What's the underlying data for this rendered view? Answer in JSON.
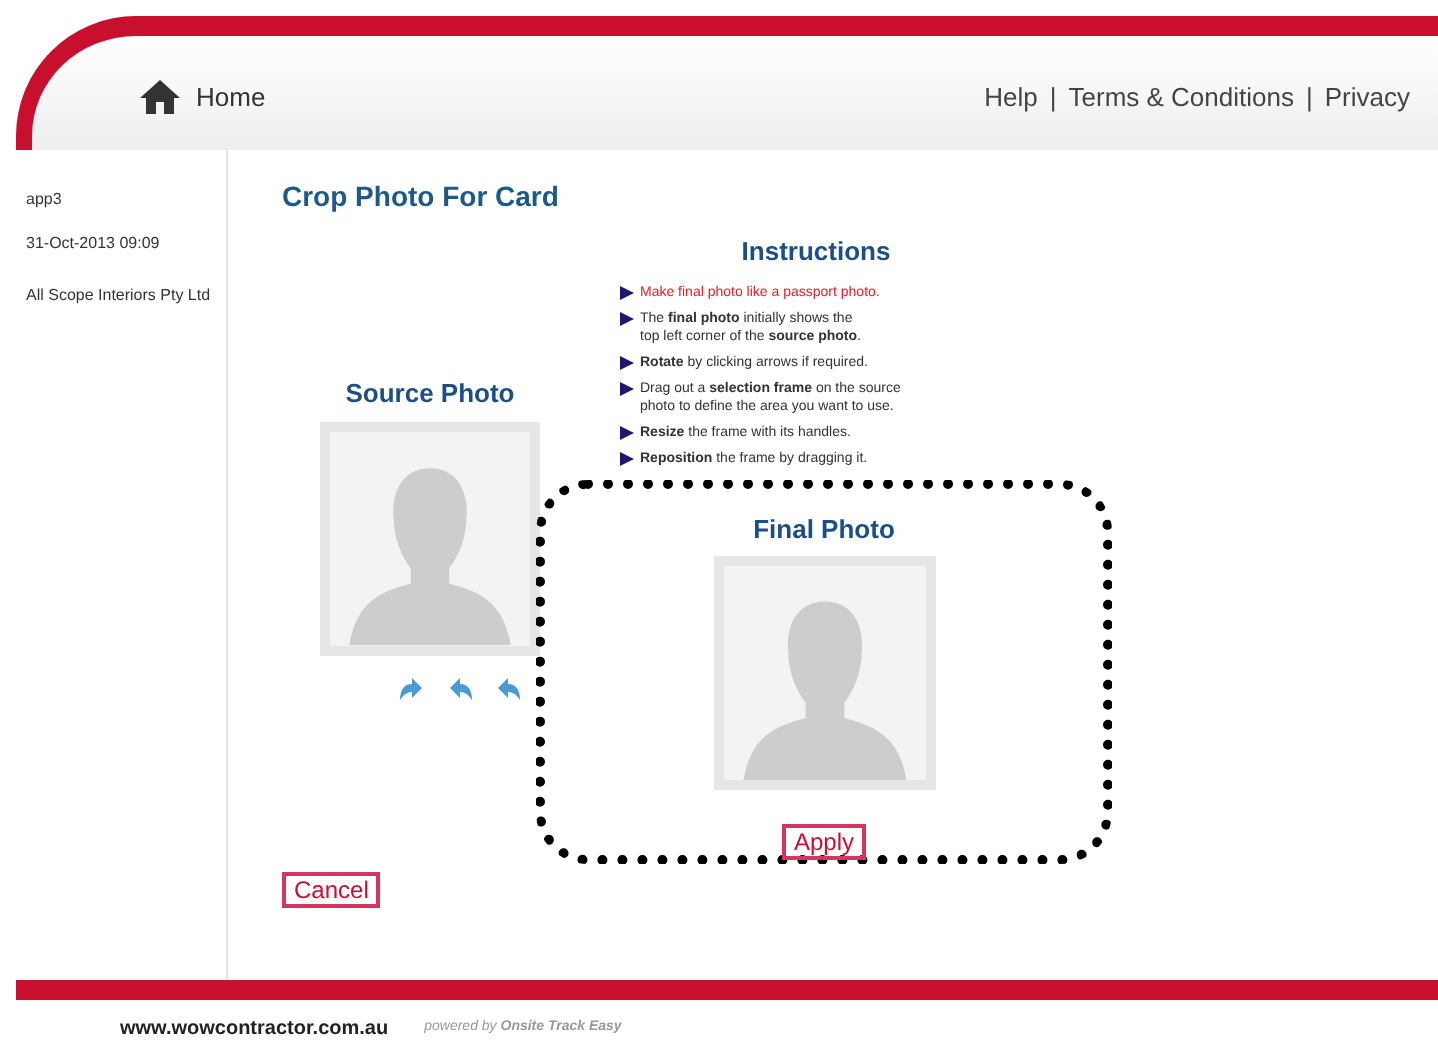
{
  "header": {
    "home": "Home",
    "links": [
      "Help",
      "Terms & Conditions",
      "Privacy"
    ],
    "separator": "|"
  },
  "sidebar": {
    "user": "app3",
    "datetime": "31-Oct-2013 09:09",
    "company": "All Scope Interiors Pty Ltd"
  },
  "page_title": "Crop Photo For Card",
  "instructions": {
    "title": "Instructions",
    "items": [
      {
        "kind": "alert",
        "text": "Make final photo like a passport photo."
      },
      {
        "kind": "note",
        "text": "The **final photo** initially shows the\ntop left corner of the **source photo**."
      },
      {
        "kind": "note",
        "text": "**Rotate** by clicking arrows if required."
      },
      {
        "kind": "note",
        "text": "Drag out a **selection frame** on the source\nphoto to define the area you want to use."
      },
      {
        "kind": "note",
        "text": "**Resize** the frame with its handles."
      },
      {
        "kind": "note",
        "text": "**Reposition** the frame by dragging it."
      }
    ]
  },
  "source_photo": {
    "title": "Source Photo"
  },
  "final_photo": {
    "title": "Final Photo",
    "apply": "Apply"
  },
  "cancel": "Cancel",
  "footer": {
    "site": "www.wowcontractor.com.au",
    "powered": "powered by **Onsite Track Easy**"
  }
}
